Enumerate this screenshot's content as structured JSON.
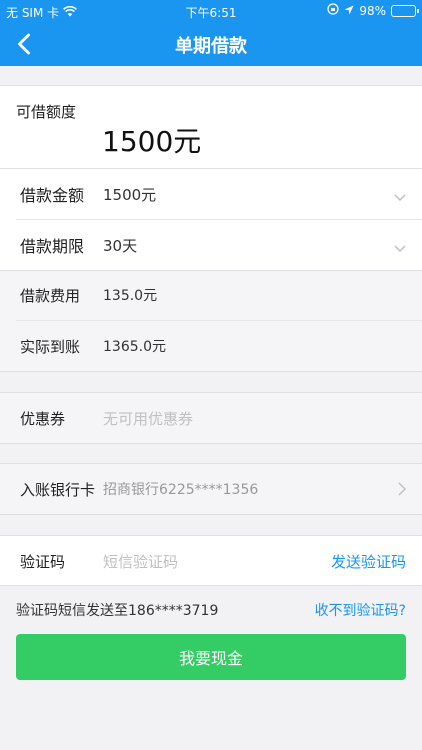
{
  "status_bar": {
    "carrier": "无 SIM 卡",
    "time": "下午6:51",
    "battery": "98%"
  },
  "nav": {
    "title": "单期借款"
  },
  "limit": {
    "label": "可借额度",
    "value": "1500元"
  },
  "loan": {
    "amount_label": "借款金额",
    "amount_value": "1500元",
    "term_label": "借款期限",
    "term_value": "30天",
    "fee_label": "借款费用",
    "fee_value": "135.0元",
    "actual_label": "实际到账",
    "actual_value": "1365.0元"
  },
  "coupon": {
    "label": "优惠券",
    "value": "无可用优惠券"
  },
  "bank": {
    "label": "入账银行卡",
    "value": "招商银行6225****1356"
  },
  "verify": {
    "label": "验证码",
    "placeholder": "短信验证码",
    "send_label": "发送验证码",
    "info": "验证码短信发送至186****3719",
    "no_code": "收不到验证码?"
  },
  "submit": {
    "label": "我要现金"
  },
  "colors": {
    "brand_blue": "#1a96f0",
    "button_green": "#34cc64"
  }
}
